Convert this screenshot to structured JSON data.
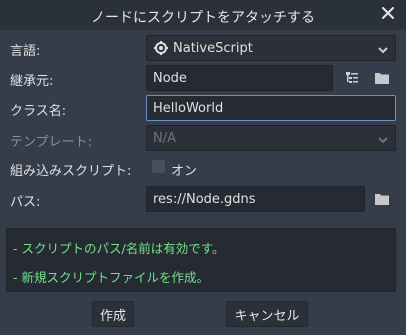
{
  "dialog": {
    "title": "ノードにスクリプトをアタッチする"
  },
  "form": {
    "language": {
      "label": "言語:",
      "value": "NativeScript",
      "icon": "gdnative-icon"
    },
    "inherits": {
      "label": "継承元:",
      "value": "Node"
    },
    "class_name": {
      "label": "クラス名:",
      "value": "HelloWorld"
    },
    "template": {
      "label": "テンプレート:",
      "value": "N/A"
    },
    "builtin": {
      "label": "組み込みスクリプト:",
      "toggle_label": "オン",
      "checked": false
    },
    "path": {
      "label": "パス:",
      "value": "res://Node.gdns"
    }
  },
  "messages": [
    "- スクリプトのパス/名前は有効です。",
    "- 新規スクリプトファイルを作成。"
  ],
  "buttons": {
    "create": "作成",
    "cancel": "キャンセル"
  },
  "colors": {
    "background": "#363d4a",
    "titlebar": "#2b313b",
    "field": "#262b33",
    "focus_border": "#6b90c8",
    "message_text": "#72e28b"
  }
}
